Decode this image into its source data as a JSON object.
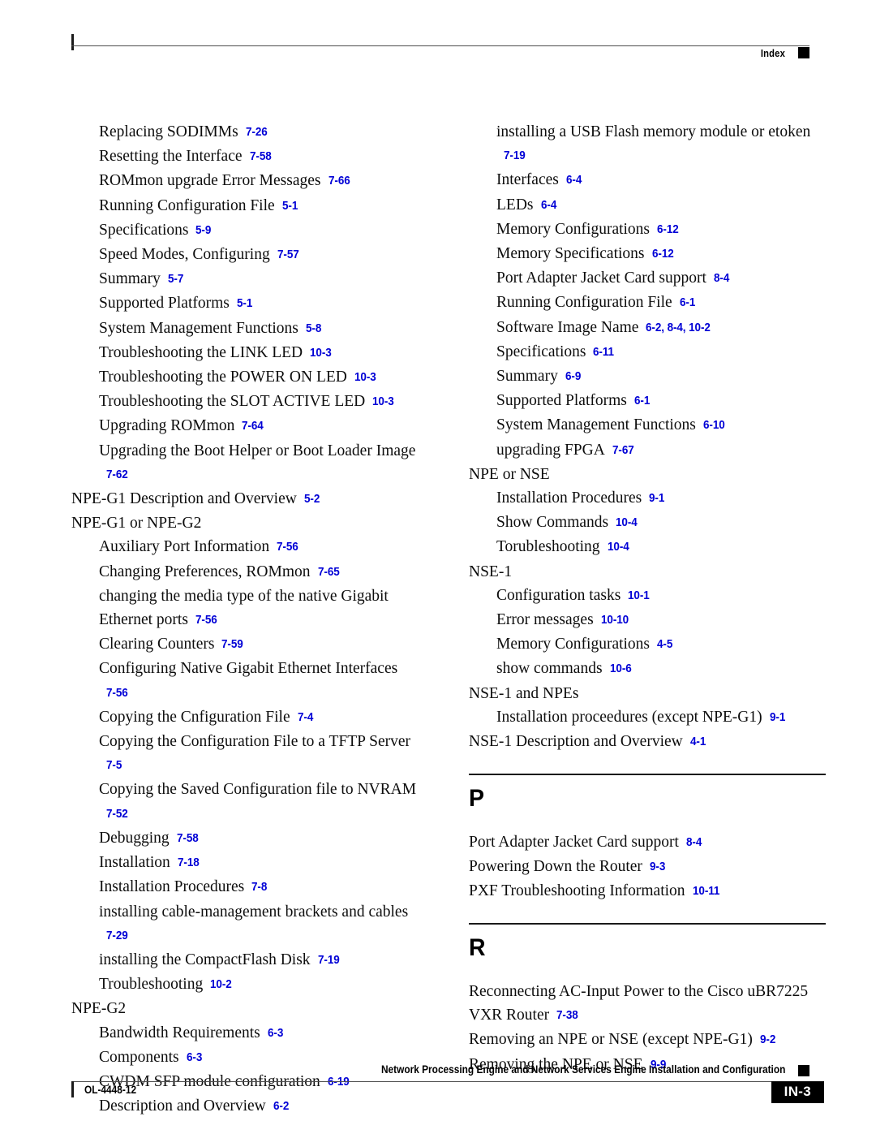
{
  "header": {
    "label": "Index",
    "marker_icon": "black-square-marker"
  },
  "footer": {
    "doc_id": "OL-4448-12",
    "title": "Network Processing Engine and Network Services Engine Installation and Configuration",
    "page_number": "IN-3",
    "marker_icon": "black-square-marker"
  },
  "columns": {
    "left": [
      {
        "kind": "entry",
        "level": 1,
        "text": "Replacing SODIMMs",
        "ref": "7-26"
      },
      {
        "kind": "entry",
        "level": 1,
        "text": "Resetting the Interface",
        "ref": "7-58"
      },
      {
        "kind": "entry",
        "level": 1,
        "text": "ROMmon upgrade Error Messages",
        "ref": "7-66"
      },
      {
        "kind": "entry",
        "level": 1,
        "text": "Running Configuration File",
        "ref": "5-1"
      },
      {
        "kind": "entry",
        "level": 1,
        "text": "Specifications",
        "ref": "5-9"
      },
      {
        "kind": "entry",
        "level": 1,
        "text": "Speed Modes, Configuring",
        "ref": "7-57"
      },
      {
        "kind": "entry",
        "level": 1,
        "text": "Summary",
        "ref": "5-7"
      },
      {
        "kind": "entry",
        "level": 1,
        "text": "Supported Platforms",
        "ref": "5-1"
      },
      {
        "kind": "entry",
        "level": 1,
        "text": "System Management Functions",
        "ref": "5-8"
      },
      {
        "kind": "entry",
        "level": 1,
        "text": "Troubleshooting the LINK LED",
        "ref": "10-3"
      },
      {
        "kind": "entry",
        "level": 1,
        "text": "Troubleshooting the POWER ON LED",
        "ref": "10-3"
      },
      {
        "kind": "entry",
        "level": 1,
        "text": "Troubleshooting the SLOT ACTIVE LED",
        "ref": "10-3"
      },
      {
        "kind": "entry",
        "level": 1,
        "text": "Upgrading ROMmon",
        "ref": "7-64"
      },
      {
        "kind": "entry",
        "level": 1,
        "text": "Upgrading the Boot Helper or Boot Loader Image",
        "ref": "7-62"
      },
      {
        "kind": "entry",
        "level": 0,
        "text": "NPE-G1 Description and Overview",
        "ref": "5-2"
      },
      {
        "kind": "entry",
        "level": 0,
        "text": "NPE-G1 or NPE-G2",
        "ref": ""
      },
      {
        "kind": "entry",
        "level": 1,
        "text": "Auxiliary Port Information",
        "ref": "7-56"
      },
      {
        "kind": "entry",
        "level": 1,
        "text": "Changing Preferences, ROMmon",
        "ref": "7-65"
      },
      {
        "kind": "entry",
        "level": 1,
        "text": "changing the media type of the native Gigabit Ethernet ports",
        "ref": "7-56"
      },
      {
        "kind": "entry",
        "level": 1,
        "text": "Clearing Counters",
        "ref": "7-59"
      },
      {
        "kind": "entry",
        "level": 1,
        "text": "Configuring Native Gigabit Ethernet Interfaces",
        "ref": "7-56"
      },
      {
        "kind": "entry",
        "level": 1,
        "text": "Copying the Cnfiguration File",
        "ref": "7-4"
      },
      {
        "kind": "entry",
        "level": 1,
        "text": "Copying the Configuration File to a TFTP Server",
        "ref": "7-5"
      },
      {
        "kind": "entry",
        "level": 1,
        "text": "Copying the Saved Configuration file to NVRAM",
        "ref": "7-52"
      },
      {
        "kind": "entry",
        "level": 1,
        "text": "Debugging",
        "ref": "7-58"
      },
      {
        "kind": "entry",
        "level": 1,
        "text": "Installation",
        "ref": "7-18"
      },
      {
        "kind": "entry",
        "level": 1,
        "text": "Installation Procedures",
        "ref": "7-8"
      },
      {
        "kind": "entry",
        "level": 1,
        "text": "installing cable-management brackets and cables",
        "ref": "7-29"
      },
      {
        "kind": "entry",
        "level": 1,
        "text": "installing the CompactFlash Disk",
        "ref": "7-19"
      },
      {
        "kind": "entry",
        "level": 1,
        "text": "Troubleshooting",
        "ref": "10-2"
      },
      {
        "kind": "entry",
        "level": 0,
        "text": "NPE-G2",
        "ref": ""
      },
      {
        "kind": "entry",
        "level": 1,
        "text": "Bandwidth Requirements",
        "ref": "6-3"
      },
      {
        "kind": "entry",
        "level": 1,
        "text": "Components",
        "ref": "6-3"
      },
      {
        "kind": "entry",
        "level": 1,
        "text": "CWDM SFP module configuration",
        "ref": "6-19"
      },
      {
        "kind": "entry",
        "level": 1,
        "text": "Description and Overview",
        "ref": "6-2"
      }
    ],
    "right": [
      {
        "kind": "entry",
        "level": 1,
        "text": "installing a USB Flash memory module or etoken",
        "ref": "7-19"
      },
      {
        "kind": "entry",
        "level": 1,
        "text": "Interfaces",
        "ref": "6-4"
      },
      {
        "kind": "entry",
        "level": 1,
        "text": "LEDs",
        "ref": "6-4"
      },
      {
        "kind": "entry",
        "level": 1,
        "text": "Memory Configurations",
        "ref": "6-12"
      },
      {
        "kind": "entry",
        "level": 1,
        "text": "Memory Specifications",
        "ref": "6-12"
      },
      {
        "kind": "entry",
        "level": 1,
        "text": "Port Adapter Jacket Card support",
        "ref": "8-4"
      },
      {
        "kind": "entry",
        "level": 1,
        "text": "Running Configuration File",
        "ref": "6-1"
      },
      {
        "kind": "entry",
        "level": 1,
        "text": "Software Image Name",
        "ref": "6-2, 8-4, 10-2"
      },
      {
        "kind": "entry",
        "level": 1,
        "text": "Specifications",
        "ref": "6-11"
      },
      {
        "kind": "entry",
        "level": 1,
        "text": "Summary",
        "ref": "6-9"
      },
      {
        "kind": "entry",
        "level": 1,
        "text": "Supported Platforms",
        "ref": "6-1"
      },
      {
        "kind": "entry",
        "level": 1,
        "text": "System Management Functions",
        "ref": "6-10"
      },
      {
        "kind": "entry",
        "level": 1,
        "text": "upgrading FPGA",
        "ref": "7-67"
      },
      {
        "kind": "entry",
        "level": 0,
        "text": "NPE or NSE",
        "ref": ""
      },
      {
        "kind": "entry",
        "level": 1,
        "text": "Installation Procedures",
        "ref": "9-1"
      },
      {
        "kind": "entry",
        "level": 1,
        "text": "Show Commands",
        "ref": "10-4"
      },
      {
        "kind": "entry",
        "level": 1,
        "text": "Torubleshooting",
        "ref": "10-4"
      },
      {
        "kind": "entry",
        "level": 0,
        "text": "NSE-1",
        "ref": ""
      },
      {
        "kind": "entry",
        "level": 1,
        "text": "Configuration tasks",
        "ref": "10-1"
      },
      {
        "kind": "entry",
        "level": 1,
        "text": "Error messages",
        "ref": "10-10"
      },
      {
        "kind": "entry",
        "level": 1,
        "text": "Memory Configurations",
        "ref": "4-5"
      },
      {
        "kind": "entry",
        "level": 1,
        "text": "show commands",
        "ref": "10-6"
      },
      {
        "kind": "entry",
        "level": 0,
        "text": "NSE-1 and NPEs",
        "ref": ""
      },
      {
        "kind": "entry",
        "level": 1,
        "text": "Installation proceedures (except NPE-G1)",
        "ref": "9-1"
      },
      {
        "kind": "entry",
        "level": 0,
        "text": "NSE-1 Description and Overview",
        "ref": "4-1"
      },
      {
        "kind": "section",
        "letter": "P"
      },
      {
        "kind": "entry",
        "level": 0,
        "text": "Port Adapter Jacket Card support",
        "ref": "8-4"
      },
      {
        "kind": "entry",
        "level": 0,
        "text": "Powering Down the Router",
        "ref": "9-3"
      },
      {
        "kind": "entry",
        "level": 0,
        "text": "PXF Troubleshooting Information",
        "ref": "10-11"
      },
      {
        "kind": "section",
        "letter": "R"
      },
      {
        "kind": "entry",
        "level": 0,
        "text": "Reconnecting AC-Input Power to the Cisco uBR7225 VXR Router",
        "ref": "7-38"
      },
      {
        "kind": "entry",
        "level": 0,
        "text": "Removing an NPE or NSE (except NPE-G1)",
        "ref": "9-2"
      },
      {
        "kind": "entry",
        "level": 0,
        "text": "Removing the NPE or NSE",
        "ref": "9-9"
      }
    ]
  }
}
